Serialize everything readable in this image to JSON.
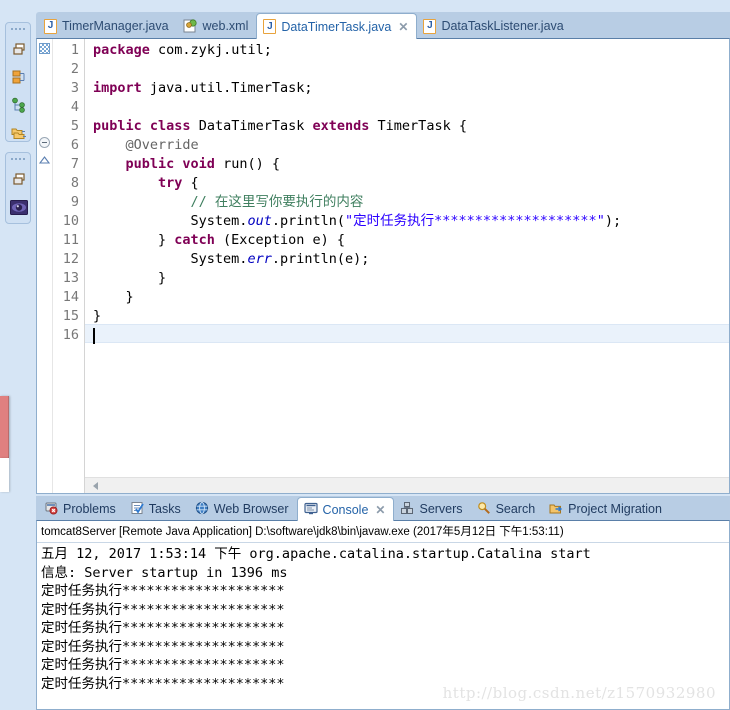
{
  "fastview": {
    "stack1": [
      {
        "name": "restore-icon",
        "label": "Restore"
      },
      {
        "name": "package-explorer-icon",
        "label": "Package Explorer"
      },
      {
        "name": "type-hierarchy-icon",
        "label": "Type Hierarchy"
      },
      {
        "name": "project-explorer-icon",
        "label": "Project Explorer"
      }
    ],
    "stack2": [
      {
        "name": "restore-icon",
        "label": "Restore"
      },
      {
        "name": "outline-view-icon",
        "label": "Outline"
      }
    ]
  },
  "editor": {
    "tabs": [
      {
        "label": "TimerManager.java",
        "icon": "java-file-icon",
        "active": false,
        "closable": false
      },
      {
        "label": "web.xml",
        "icon": "xml-file-icon",
        "active": false,
        "closable": false
      },
      {
        "label": "DataTimerTask.java",
        "icon": "java-file-icon",
        "active": true,
        "closable": true,
        "close_label": "✕"
      },
      {
        "label": "DataTaskListener.java",
        "icon": "java-file-icon",
        "active": false,
        "closable": false
      }
    ],
    "line_numbers": [
      "1",
      "2",
      "3",
      "4",
      "5",
      "6",
      "7",
      "8",
      "9",
      "10",
      "11",
      "12",
      "13",
      "14",
      "15",
      "16"
    ],
    "code": [
      "package com.zykj.util;",
      "",
      "import java.util.TimerTask;",
      "",
      "public class DataTimerTask extends TimerTask {",
      "    @Override",
      "    public void run() {",
      "        try {",
      "            // 在这里写你要执行的内容",
      "            System.out.println(\"定时任务执行********************\");",
      "        } catch (Exception e) {",
      "            System.err.println(e);",
      "        }",
      "    }",
      "}",
      ""
    ],
    "string_literal": "定时任务执行********************",
    "comment_text": "// 在这里写你要执行的内容",
    "caret_line": 16,
    "package_name": "com.zykj.util",
    "import_name": "java.util.TimerTask",
    "class_name": "DataTimerTask",
    "super_class": "TimerTask",
    "method_name": "run",
    "annotation": "@Override"
  },
  "bottom": {
    "tabs": [
      {
        "label": "Problems",
        "icon": "problems-icon",
        "active": false,
        "closable": false
      },
      {
        "label": "Tasks",
        "icon": "tasks-icon",
        "active": false,
        "closable": false
      },
      {
        "label": "Web Browser",
        "icon": "web-browser-icon",
        "active": false,
        "closable": false
      },
      {
        "label": "Console",
        "icon": "console-icon",
        "active": true,
        "closable": true,
        "close_label": "✕"
      },
      {
        "label": "Servers",
        "icon": "servers-icon",
        "active": false,
        "closable": false
      },
      {
        "label": "Search",
        "icon": "search-icon",
        "active": false,
        "closable": false
      },
      {
        "label": "Project Migration",
        "icon": "project-migration-icon",
        "active": false,
        "closable": false
      }
    ],
    "console_header": "tomcat8Server [Remote Java Application] D:\\software\\jdk8\\bin\\javaw.exe (2017年5月12日 下午1:53:11)",
    "console_lines": [
      "五月 12, 2017 1:53:14 下午 org.apache.catalina.startup.Catalina start",
      "信息: Server startup in 1396 ms",
      "定时任务执行********************",
      "定时任务执行********************",
      "定时任务执行********************",
      "定时任务执行********************",
      "定时任务执行********************",
      "定时任务执行********************"
    ]
  },
  "watermark": "http://blog.csdn.net/z1570932980",
  "colors": {
    "chrome": "#d6e5f5",
    "tab_bar": "#b8cde4",
    "keyword": "#7f0055",
    "string": "#2a00ff",
    "comment": "#3f7f5f",
    "field": "#0000c0",
    "marker_red": "#e08080"
  }
}
